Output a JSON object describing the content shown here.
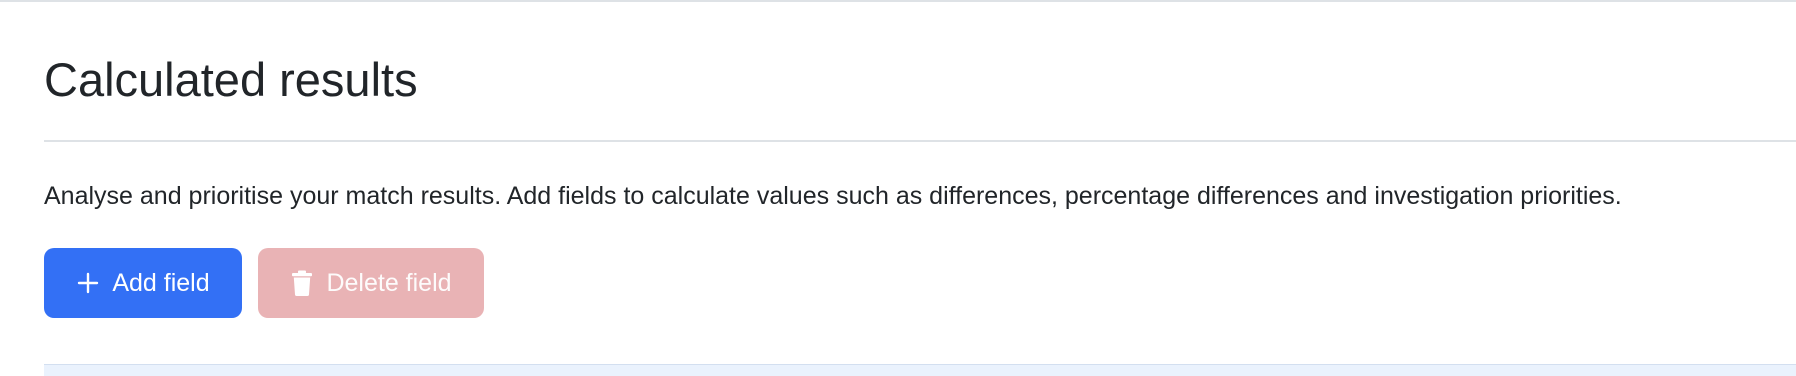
{
  "section": {
    "title": "Calculated results",
    "description": "Analyse and prioritise your match results. Add fields to calculate values such as differences, percentage differences and investigation priorities."
  },
  "actions": {
    "add_field": {
      "label": "Add field",
      "icon": "plus-icon",
      "color": "#3370f5",
      "enabled": true
    },
    "delete_field": {
      "label": "Delete field",
      "icon": "trash-icon",
      "color": "#e9b3b5",
      "enabled": false
    }
  }
}
